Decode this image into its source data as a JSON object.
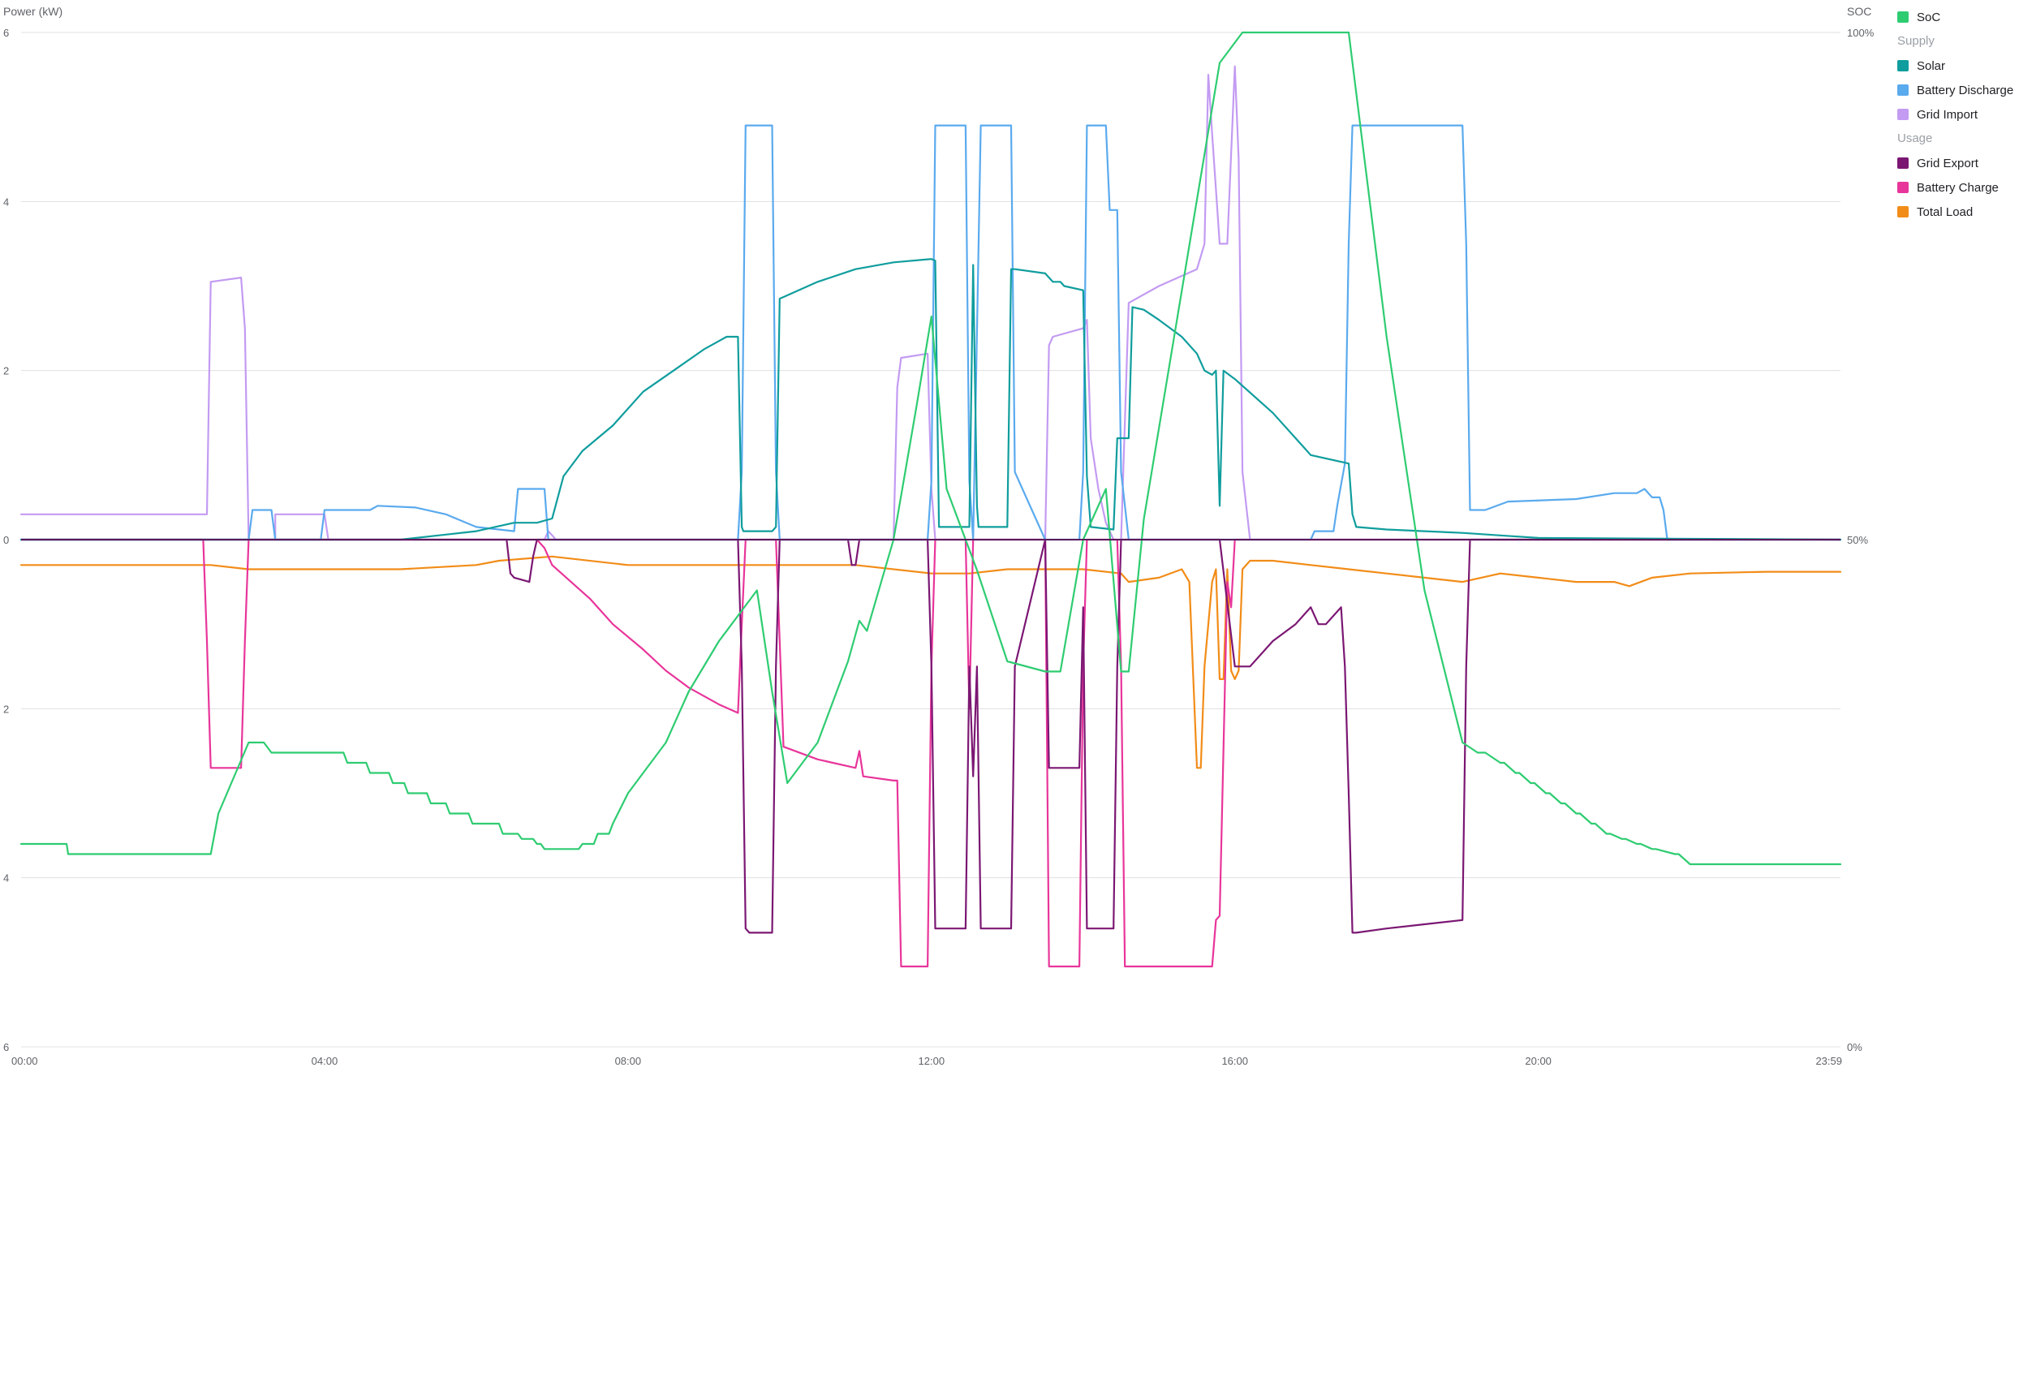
{
  "chart_data": {
    "type": "line",
    "left_axis": {
      "title": "Power (kW)",
      "range": [
        -6,
        6
      ],
      "tick_values": [
        6,
        4,
        2,
        0,
        -2,
        -4,
        -6
      ],
      "tick_labels": [
        "6",
        "4",
        "2",
        "0",
        "2",
        "4",
        "6"
      ]
    },
    "right_axis": {
      "title": "SOC",
      "range": [
        0,
        100
      ],
      "tick_values": [
        100,
        50,
        0
      ],
      "tick_labels": [
        "100%",
        "50%",
        "0%"
      ]
    },
    "x_axis": {
      "range": [
        0,
        23.983
      ],
      "tick_values": [
        0,
        4,
        8,
        12,
        16,
        20,
        23.983
      ],
      "tick_labels": [
        "00:00",
        "04:00",
        "08:00",
        "12:00",
        "16:00",
        "20:00",
        "23:59"
      ]
    },
    "grid": true,
    "legend": {
      "placement": "right",
      "entries": [
        {
          "kind": "item",
          "label": "SoC",
          "color": "#2ecc71"
        },
        {
          "kind": "group",
          "label": "Supply"
        },
        {
          "kind": "item",
          "label": "Solar",
          "color": "#109d9d"
        },
        {
          "kind": "item",
          "label": "Battery Discharge",
          "color": "#5aaaee"
        },
        {
          "kind": "item",
          "label": "Grid Import",
          "color": "#c39bf2"
        },
        {
          "kind": "group",
          "label": "Usage"
        },
        {
          "kind": "item",
          "label": "Grid Export",
          "color": "#7b1773"
        },
        {
          "kind": "item",
          "label": "Battery Charge",
          "color": "#e8359a"
        },
        {
          "kind": "item",
          "label": "Total Load",
          "color": "#f28c18"
        }
      ]
    },
    "series": [
      {
        "name": "SoC",
        "axis": "right",
        "color": "#2ecc71",
        "x": [
          0,
          0.6,
          0.62,
          2.5,
          2.6,
          3.0,
          3.2,
          3.3,
          4.25,
          4.3,
          4.55,
          4.6,
          4.85,
          4.9,
          5.05,
          5.1,
          5.35,
          5.4,
          5.6,
          5.65,
          5.9,
          5.95,
          6.3,
          6.35,
          6.55,
          6.6,
          6.75,
          6.8,
          6.85,
          6.9,
          7.35,
          7.4,
          7.55,
          7.6,
          7.75,
          7.8,
          8.0,
          8.5,
          8.8,
          9.2,
          9.5,
          9.7,
          9.9,
          10.1,
          10.5,
          10.9,
          11.05,
          11.15,
          11.5,
          11.8,
          12.0,
          12.2,
          12.6,
          13.0,
          13.5,
          13.7,
          14.0,
          14.3,
          14.5,
          14.6,
          14.8,
          15.2,
          15.6,
          15.8,
          16.0,
          16.1,
          17.5,
          18.0,
          18.5,
          19.0,
          19.2,
          19.3,
          19.5,
          19.55,
          19.7,
          19.75,
          19.9,
          19.95,
          20.1,
          20.15,
          20.3,
          20.35,
          20.5,
          20.55,
          20.7,
          20.75,
          20.9,
          20.95,
          21.1,
          21.15,
          21.3,
          21.35,
          21.5,
          21.55,
          21.8,
          21.85,
          22.0,
          23.983
        ],
        "y": [
          20,
          20,
          19,
          19,
          23,
          30,
          30,
          29,
          29,
          28,
          28,
          27,
          27,
          26,
          26,
          25,
          25,
          24,
          24,
          23,
          23,
          22,
          22,
          21,
          21,
          20.5,
          20.5,
          20,
          20,
          19.5,
          19.5,
          20,
          20,
          21,
          21,
          22,
          25,
          30,
          35,
          40,
          43,
          45,
          35,
          26,
          30,
          38,
          42,
          41,
          50,
          63,
          72,
          55,
          47,
          38,
          37,
          37,
          50,
          55,
          37,
          37,
          52,
          70,
          88,
          97,
          99,
          100,
          100,
          70,
          45,
          30,
          29,
          29,
          28,
          28,
          27,
          27,
          26,
          26,
          25,
          25,
          24,
          24,
          23,
          23,
          22,
          22,
          21,
          21,
          20.5,
          20.5,
          20,
          20,
          19.5,
          19.5,
          19,
          19,
          18,
          18
        ]
      },
      {
        "name": "Solar",
        "axis": "left",
        "color": "#109d9d",
        "x": [
          0,
          5.0,
          5.5,
          6.0,
          6.5,
          6.8,
          7.0,
          7.15,
          7.4,
          7.8,
          8.2,
          8.6,
          9.0,
          9.3,
          9.45,
          9.5,
          9.52,
          9.9,
          9.95,
          10.0,
          10.5,
          11.0,
          11.5,
          12.0,
          12.05,
          12.1,
          12.5,
          12.55,
          12.6,
          12.62,
          13.0,
          13.05,
          13.1,
          13.5,
          13.55,
          13.6,
          13.7,
          13.75,
          14.0,
          14.05,
          14.1,
          14.4,
          14.45,
          14.6,
          14.65,
          14.8,
          15.0,
          15.3,
          15.5,
          15.6,
          15.7,
          15.75,
          15.8,
          15.85,
          16.0,
          16.5,
          16.9,
          17.0,
          17.5,
          17.55,
          17.6,
          18.0,
          18.5,
          19.0,
          19.5,
          20.0,
          23.983
        ],
        "y": [
          0,
          0,
          0.05,
          0.1,
          0.2,
          0.2,
          0.25,
          0.75,
          1.05,
          1.35,
          1.75,
          2.0,
          2.25,
          2.4,
          2.4,
          0.15,
          0.1,
          0.1,
          0.15,
          2.85,
          3.05,
          3.2,
          3.28,
          3.32,
          3.3,
          0.15,
          0.15,
          3.25,
          0.4,
          0.15,
          0.15,
          3.2,
          3.2,
          3.15,
          3.1,
          3.05,
          3.05,
          3.0,
          2.95,
          0.75,
          0.15,
          0.12,
          1.2,
          1.2,
          2.75,
          2.72,
          2.6,
          2.4,
          2.2,
          2.0,
          1.95,
          2.0,
          0.4,
          2.0,
          1.9,
          1.5,
          1.1,
          1.0,
          0.9,
          0.3,
          0.15,
          0.12,
          0.1,
          0.08,
          0.05,
          0.02,
          0
        ]
      },
      {
        "name": "Battery Discharge",
        "axis": "left",
        "color": "#5aaaee",
        "x": [
          0,
          3.0,
          3.05,
          3.3,
          3.35,
          3.95,
          4.0,
          4.6,
          4.7,
          5.2,
          5.6,
          6.0,
          6.5,
          6.55,
          6.9,
          6.95,
          7.5,
          9.45,
          9.5,
          9.55,
          9.65,
          9.9,
          9.95,
          10.0,
          11.95,
          12.0,
          12.05,
          12.45,
          12.5,
          12.55,
          12.65,
          12.7,
          13.05,
          13.1,
          13.5,
          13.55,
          13.95,
          14.0,
          14.05,
          14.3,
          14.35,
          14.45,
          14.5,
          14.6,
          14.65,
          17.0,
          17.05,
          17.3,
          17.35,
          17.45,
          17.5,
          17.55,
          19.0,
          19.05,
          19.1,
          19.3,
          19.6,
          20.5,
          21.0,
          21.3,
          21.4,
          21.5,
          21.6,
          21.65,
          21.7,
          22.0,
          22.5,
          23.0,
          23.5,
          23.983
        ],
        "y": [
          0,
          0,
          0.35,
          0.35,
          0,
          0,
          0.35,
          0.35,
          0.4,
          0.38,
          0.3,
          0.15,
          0.1,
          0.6,
          0.6,
          0,
          0,
          0,
          0.8,
          4.9,
          4.9,
          4.9,
          0.8,
          0,
          0,
          0.7,
          4.9,
          4.9,
          0.7,
          0,
          4.9,
          4.9,
          4.9,
          0.8,
          0,
          0,
          0,
          0.8,
          4.9,
          4.9,
          3.9,
          3.9,
          0.8,
          0,
          0,
          0,
          0.1,
          0.1,
          0.4,
          0.9,
          3.5,
          4.9,
          4.9,
          3.5,
          0.35,
          0.35,
          0.45,
          0.48,
          0.55,
          0.55,
          0.6,
          0.5,
          0.5,
          0.35,
          0,
          0,
          0,
          0,
          0,
          0
        ]
      },
      {
        "name": "Grid Import",
        "axis": "left",
        "color": "#c39bf2",
        "x": [
          0,
          2.4,
          2.45,
          2.5,
          2.9,
          2.95,
          3.0,
          3.3,
          3.35,
          3.35,
          3.9,
          4.0,
          4.05,
          4.1,
          6.5,
          6.6,
          6.8,
          6.9,
          6.95,
          7.0,
          7.05,
          9.5,
          11.5,
          11.55,
          11.6,
          11.95,
          12.0,
          12.05,
          13.5,
          13.55,
          13.6,
          14.0,
          14.05,
          14.1,
          14.2,
          14.3,
          14.4,
          14.5,
          14.6,
          15.0,
          15.5,
          15.6,
          15.65,
          15.7,
          15.8,
          15.9,
          16.0,
          16.05,
          16.1,
          16.2,
          23.983
        ],
        "y": [
          0.3,
          0.3,
          0.3,
          3.05,
          3.1,
          2.5,
          0,
          0,
          0,
          0.3,
          0.3,
          0.3,
          0,
          0,
          0,
          0,
          0,
          0,
          0.1,
          0.05,
          0,
          0,
          0,
          1.8,
          2.15,
          2.2,
          0.6,
          0,
          0,
          2.3,
          2.4,
          2.5,
          2.6,
          1.2,
          0.6,
          0.2,
          0,
          0,
          2.8,
          3.0,
          3.2,
          3.5,
          5.5,
          4.8,
          3.5,
          3.5,
          5.6,
          4.5,
          0.8,
          0,
          0
        ]
      },
      {
        "name": "Grid Export",
        "axis": "left",
        "color": "#7b1773",
        "x": [
          0,
          6.4,
          6.45,
          6.5,
          6.7,
          6.75,
          6.8,
          9.45,
          9.5,
          9.55,
          9.6,
          9.9,
          9.95,
          10.0,
          10.9,
          10.95,
          11.0,
          11.05,
          11.95,
          12.0,
          12.05,
          12.45,
          12.5,
          12.55,
          12.6,
          12.65,
          12.7,
          13.05,
          13.1,
          13.5,
          13.55,
          13.95,
          14.0,
          14.05,
          14.4,
          14.45,
          14.5,
          15.8,
          16.0,
          16.1,
          16.2,
          16.5,
          16.8,
          17.0,
          17.1,
          17.2,
          17.4,
          17.45,
          17.5,
          17.55,
          17.6,
          18.0,
          18.5,
          19.0,
          19.05,
          19.1,
          23.983
        ],
        "y": [
          0,
          0,
          -0.4,
          -0.45,
          -0.5,
          -0.2,
          0,
          0,
          -1.5,
          -4.6,
          -4.65,
          -4.65,
          -1.5,
          0,
          0,
          -0.3,
          -0.3,
          0,
          0,
          -1.5,
          -4.6,
          -4.6,
          -1.5,
          -2.8,
          -1.5,
          -4.6,
          -4.6,
          -4.6,
          -1.5,
          0,
          -2.7,
          -2.7,
          -0.8,
          -4.6,
          -4.6,
          -1.5,
          0,
          0,
          -1.5,
          -1.5,
          -1.5,
          -1.2,
          -1.0,
          -0.8,
          -1.0,
          -1.0,
          -0.8,
          -1.5,
          -3.0,
          -4.65,
          -4.65,
          -4.6,
          -4.55,
          -4.5,
          -1.5,
          0,
          0
        ]
      },
      {
        "name": "Battery Charge",
        "axis": "left",
        "color": "#e8359a",
        "x": [
          0,
          2.4,
          2.45,
          2.5,
          2.9,
          2.95,
          3.0,
          6.8,
          6.9,
          7.0,
          7.5,
          7.8,
          8.2,
          8.5,
          8.8,
          9.2,
          9.45,
          9.5,
          9.55,
          9.95,
          10.0,
          10.05,
          10.5,
          11.0,
          11.05,
          11.1,
          11.5,
          11.55,
          11.6,
          11.95,
          12.0,
          12.05,
          12.45,
          12.5,
          12.55,
          12.65,
          12.7,
          13.5,
          13.55,
          13.6,
          13.95,
          14.0,
          14.05,
          14.45,
          14.5,
          14.55,
          15.7,
          15.75,
          15.8,
          15.9,
          15.95,
          16.0,
          23.983
        ],
        "y": [
          0,
          0,
          -1.2,
          -2.7,
          -2.7,
          -1.2,
          0,
          0,
          -0.1,
          -0.3,
          -0.7,
          -1.0,
          -1.3,
          -1.55,
          -1.75,
          -1.95,
          -2.05,
          -1.0,
          0,
          0,
          -1.2,
          -2.45,
          -2.6,
          -2.7,
          -2.5,
          -2.8,
          -2.85,
          -2.85,
          -5.05,
          -5.05,
          -1.5,
          0,
          0,
          -2.0,
          0,
          0,
          0,
          0,
          -5.05,
          -5.05,
          -5.05,
          -1.5,
          0,
          0,
          -1.5,
          -5.05,
          -5.05,
          -4.5,
          -4.45,
          -0.5,
          -0.8,
          0,
          0
        ]
      },
      {
        "name": "Total Load",
        "axis": "left",
        "color": "#f28c18",
        "x": [
          0,
          2.5,
          3.0,
          5.0,
          6.0,
          6.3,
          7.0,
          8.0,
          9.45,
          9.5,
          11.0,
          12.0,
          12.5,
          13.0,
          13.5,
          14.0,
          14.5,
          14.6,
          15.0,
          15.3,
          15.4,
          15.5,
          15.55,
          15.6,
          15.7,
          15.75,
          15.8,
          15.85,
          15.9,
          15.95,
          16.0,
          16.05,
          16.1,
          16.2,
          16.5,
          17.0,
          17.5,
          18.0,
          18.5,
          19.0,
          19.5,
          20.0,
          20.5,
          21.0,
          21.2,
          21.5,
          22.0,
          23.0,
          23.983
        ],
        "y": [
          -0.3,
          -0.3,
          -0.35,
          -0.35,
          -0.3,
          -0.25,
          -0.2,
          -0.3,
          -0.3,
          -0.3,
          -0.3,
          -0.4,
          -0.4,
          -0.35,
          -0.35,
          -0.35,
          -0.4,
          -0.5,
          -0.45,
          -0.35,
          -0.5,
          -2.7,
          -2.7,
          -1.5,
          -0.5,
          -0.35,
          -1.65,
          -1.65,
          -0.35,
          -1.55,
          -1.65,
          -1.55,
          -0.35,
          -0.25,
          -0.25,
          -0.3,
          -0.35,
          -0.4,
          -0.45,
          -0.5,
          -0.4,
          -0.45,
          -0.5,
          -0.5,
          -0.55,
          -0.45,
          -0.4,
          -0.38,
          -0.38
        ]
      }
    ]
  }
}
